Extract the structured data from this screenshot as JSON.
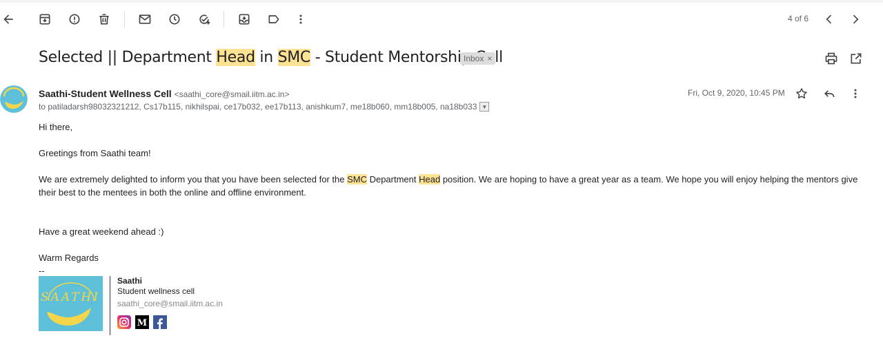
{
  "toolbar": {
    "pager": "4 of 6"
  },
  "email": {
    "subject_parts": {
      "p1": "Selected || Department ",
      "p2": "Head",
      "p3": " in ",
      "p4": "SMC",
      "p5": " - Student Mentorship Cell"
    },
    "label": "Inbox",
    "label_close": "×",
    "sender_name": "Saathi-Student Wellness Cell",
    "sender_email": "<saathi_core@smail.iitm.ac.in>",
    "recipients": "to patiladarsh98032321212, Cs17b115, nikhilspai, ce17b032, ee17b113, anishkum7, me18b060, mm18b005, na18b033",
    "date": "Fri, Oct 9, 2020, 10:45 PM",
    "body": {
      "greeting": "Hi there,",
      "line1": "Greetings from Saathi team!",
      "para_a": "We are extremely delighted to inform you that you have been selected for the ",
      "para_smc": "SMC",
      "para_b": " Department ",
      "para_head": "Head",
      "para_c": " position. We are hoping to have a great year as a team. We hope you will enjoy helping the mentors give their best to the mentees in both the online and offline environment.",
      "weekend": "Have a great weekend ahead :)",
      "regards": "Warm Regards",
      "dashes": "--"
    },
    "signature": {
      "name": "Saathi",
      "role": "Student wellness cell",
      "email": "saathi_core@smail.iitm.ac.in",
      "logo_text": "SAATHI",
      "icons": [
        "instagram-icon",
        "medium-icon",
        "facebook-icon"
      ]
    }
  },
  "colors": {
    "highlight": "#fde293",
    "logo_bg": "#5ec0d8",
    "logo_yellow": "#f5d54a"
  }
}
